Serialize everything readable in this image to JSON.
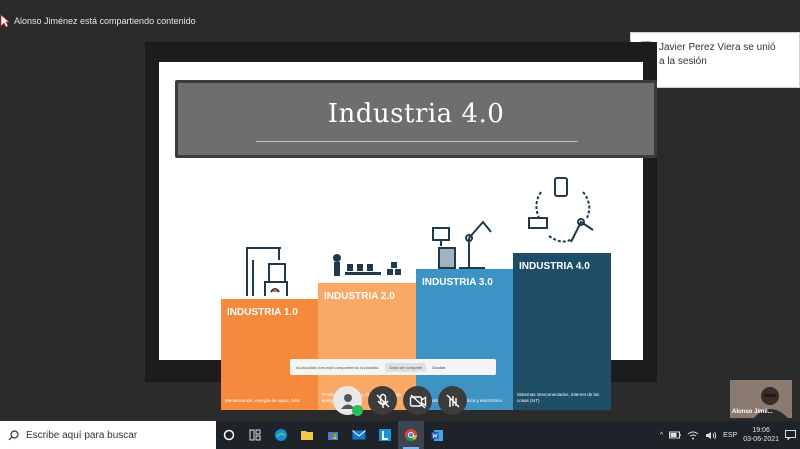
{
  "share_banner": {
    "text": "Alonso Jiménez está compartiendo contenido"
  },
  "notification": {
    "line1": "Javier Perez Viera se unió",
    "line2": "a la sesión"
  },
  "slide": {
    "title": "Industria 4.0",
    "steps": [
      {
        "title": "INDUSTRIA 1.0",
        "desc": "Mecanización, energía de vapor, telar",
        "color": "#f58a3c"
      },
      {
        "title": "INDUSTRIA 2.0",
        "desc": "Producción en masa, líneas de montaje, energía eléctrica",
        "color": "#f9a865"
      },
      {
        "title": "INDUSTRIA 3.0",
        "desc": "Automatización, informática y electrónica",
        "color": "#3c93c4"
      },
      {
        "title": "INDUSTRIA 4.0",
        "desc": "Sistemas interconectados, internet de las cosas (IoT)",
        "color": "#1e4d68"
      }
    ]
  },
  "presenter_bar": {
    "text": "us.bbcollab.com está compartiendo la pantalla.",
    "stop_label": "Dejar de compartir",
    "hide_label": "Ocultar"
  },
  "controls": {
    "avatar": "avatar-icon",
    "mic": "mic-off-icon",
    "camera": "camera-off-icon",
    "hand": "raise-hand-off-icon",
    "accent": "#2dbd5a"
  },
  "participant_video": {
    "name": "Alonso Jimé..."
  },
  "taskbar": {
    "search_placeholder": "Escribe aquí para buscar",
    "apps": [
      "task-view-icon",
      "widgets-icon",
      "edge-icon",
      "file-explorer-icon",
      "store-icon",
      "mail-icon",
      "lync-icon",
      "chrome-icon",
      "word-icon"
    ],
    "language": "ESP",
    "time": "19:06",
    "date": "03-06-2021"
  }
}
